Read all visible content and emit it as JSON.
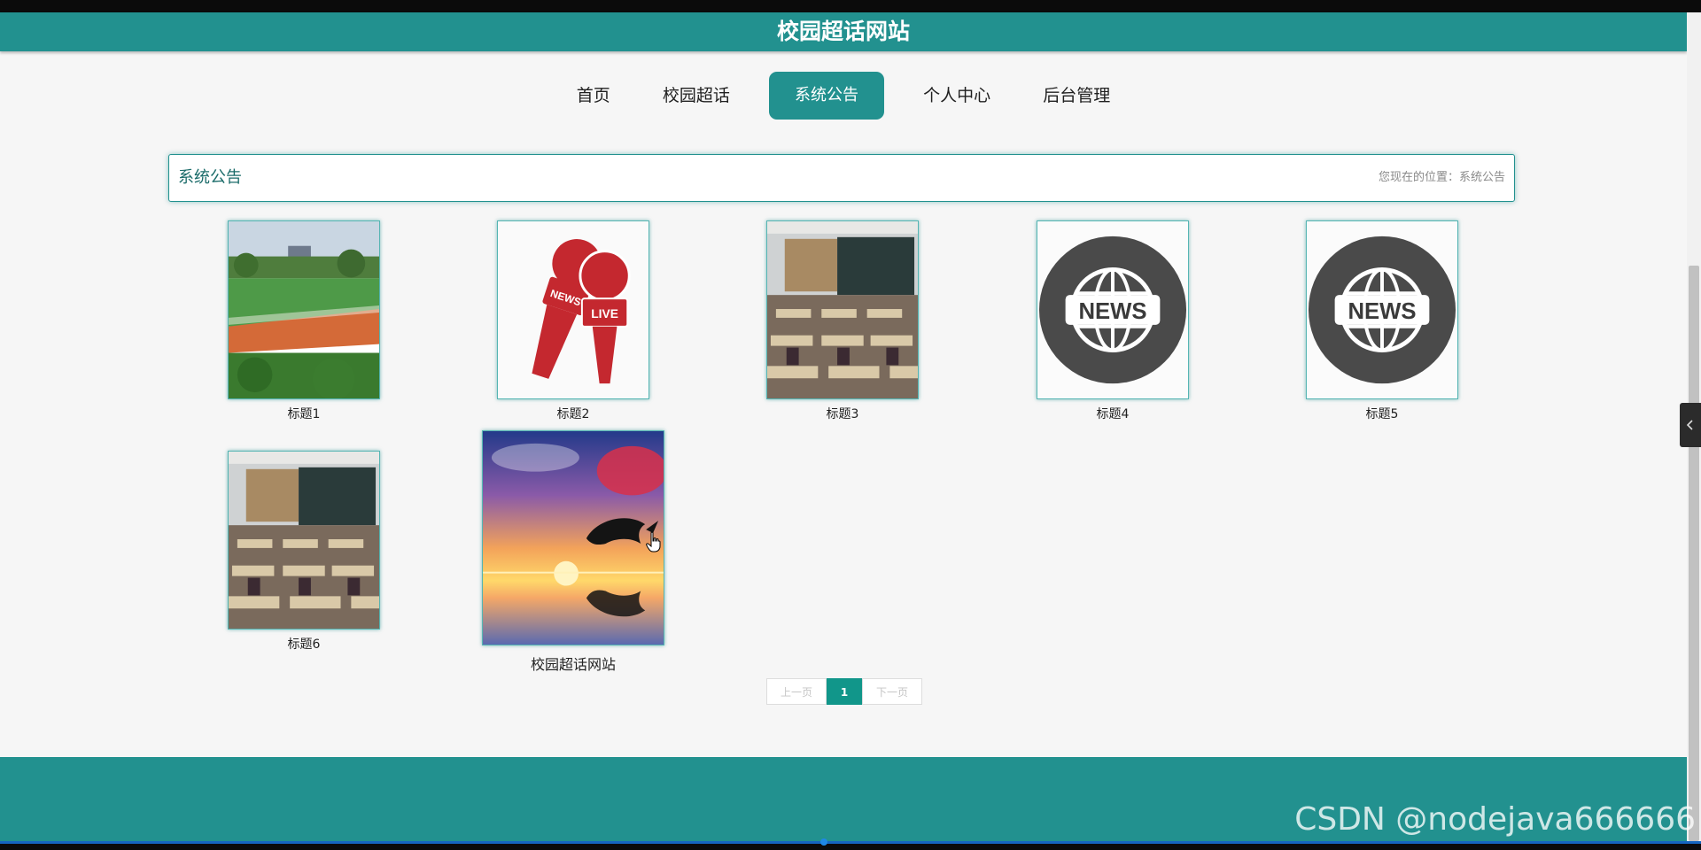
{
  "site": {
    "title": "校园超话网站"
  },
  "nav": {
    "items": [
      {
        "label": "首页",
        "active": false
      },
      {
        "label": "校园超话",
        "active": false
      },
      {
        "label": "系统公告",
        "active": true
      },
      {
        "label": "个人中心",
        "active": false
      },
      {
        "label": "后台管理",
        "active": false
      }
    ]
  },
  "breadcrumb": {
    "section_title": "系统公告",
    "location_text": "您现在的位置：系统公告"
  },
  "announcements": [
    {
      "title": "标题1",
      "image": "campus-track-photo"
    },
    {
      "title": "标题2",
      "image": "news-live-microphones"
    },
    {
      "title": "标题3",
      "image": "classroom-photo"
    },
    {
      "title": "标题4",
      "image": "news-globe-icon"
    },
    {
      "title": "标题5",
      "image": "news-globe-icon"
    },
    {
      "title": "标题6",
      "image": "classroom-photo"
    },
    {
      "title": "校园超话网站",
      "image": "dolphin-sunset-photo"
    }
  ],
  "pagination": {
    "prev": "上一页",
    "current": "1",
    "next": "下一页"
  },
  "watermark": "CSDN @nodejava666666",
  "colors": {
    "primary": "#22918f",
    "page_bg": "#f6f6f6",
    "pagination_active": "#11968a"
  }
}
